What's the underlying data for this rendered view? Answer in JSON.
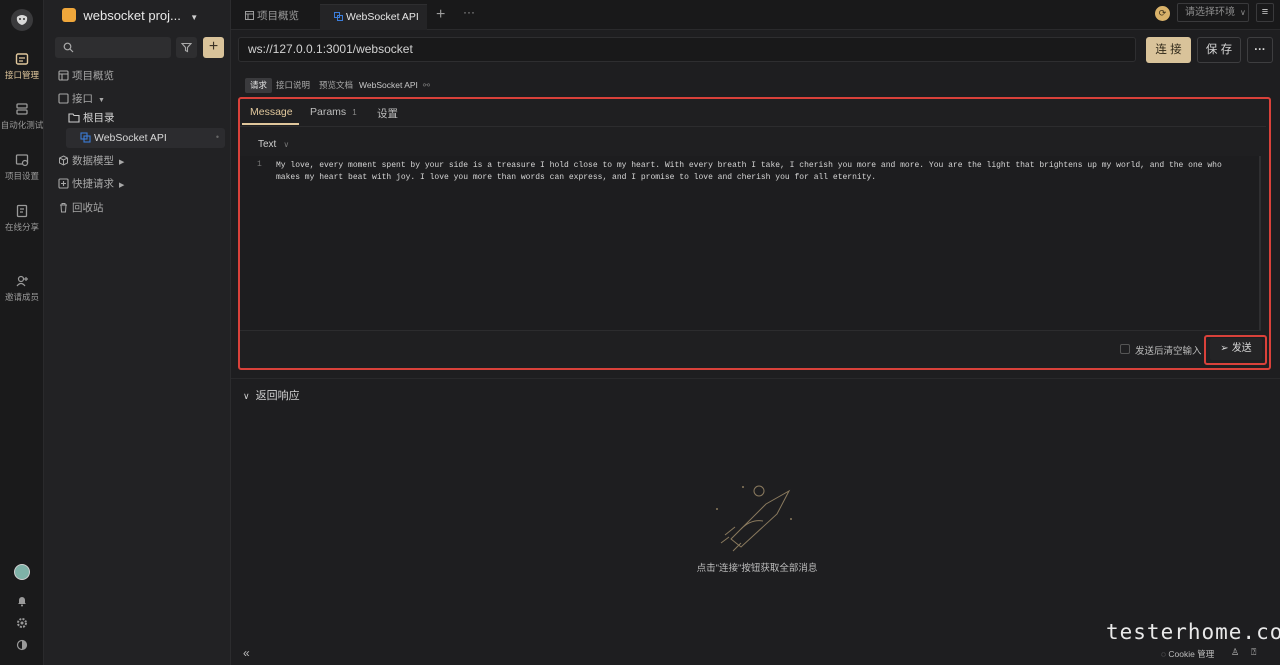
{
  "rail": {
    "items": [
      {
        "label": "接口管理",
        "icon": "api-manage-icon"
      },
      {
        "label": "自动化测试",
        "icon": "automation-icon"
      },
      {
        "label": "项目设置",
        "icon": "project-settings-icon"
      },
      {
        "label": "在线分享",
        "icon": "share-icon"
      },
      {
        "label": "邀请成员",
        "icon": "invite-icon"
      }
    ]
  },
  "sidebar": {
    "project_name": "websocket proj...",
    "items": {
      "overview": "项目概览",
      "interfaces": "接口",
      "root": "根目录",
      "ws_api": "WebSocket API",
      "data_model": "数据模型",
      "quick_request": "快捷请求",
      "recycle": "回收站"
    }
  },
  "tabs": {
    "overview": "项目概览",
    "ws_api": "WebSocket API",
    "env_placeholder": "请选择环境"
  },
  "request": {
    "url": "ws://127.0.0.1:3001/websocket",
    "connect_label": "连 接",
    "save_label": "保 存",
    "more_label": "···",
    "sub_tabs": [
      "请求",
      "接口说明",
      "预览文档"
    ],
    "api_name": "WebSocket API"
  },
  "message": {
    "tabs": {
      "message": "Message",
      "params": "Params",
      "params_count": "1",
      "settings": "设置"
    },
    "format": "Text",
    "line_number": "1",
    "line1": "My love, every moment spent by your side is a treasure I hold close to my heart. With every breath I take, I cherish you more and more. You are the light that brightens up my world, and the one who",
    "line2": "makes my heart beat with joy. I love you more than words can express, and I promise to love and cherish you for all eternity.",
    "clear_after_send": "发送后清空输入",
    "send_label": "发送"
  },
  "response": {
    "title": "返回响应",
    "empty_hint": "点击\"连接\"按钮获取全部消息"
  },
  "footer": {
    "watermark": "testerhome.com",
    "cookie": "Cookie 管理"
  },
  "colors": {
    "accent": "#e0c79c",
    "highlight_box": "#d9413a",
    "link": "#3c7dd9"
  }
}
